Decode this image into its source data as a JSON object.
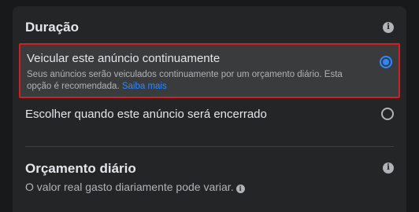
{
  "duration": {
    "title": "Duração",
    "info_icon": "i",
    "option_continuous": {
      "title": "Veicular este anúncio continuamente",
      "description": "Seus anúncios serão veiculados continuamente por um orçamento diário. Esta opção é recomendada.",
      "link": "Saiba mais",
      "selected": true
    },
    "option_end_date": {
      "title": "Escolher quando este anúncio será encerrado",
      "selected": false
    }
  },
  "budget": {
    "title": "Orçamento diário",
    "subtitle": "O valor real gasto diariamente pode variar.",
    "info_icon": "i"
  },
  "colors": {
    "accent": "#2d88ff",
    "highlight_border": "#d21f26",
    "panel_bg": "#242526",
    "selected_bg": "#3a3b3c"
  }
}
